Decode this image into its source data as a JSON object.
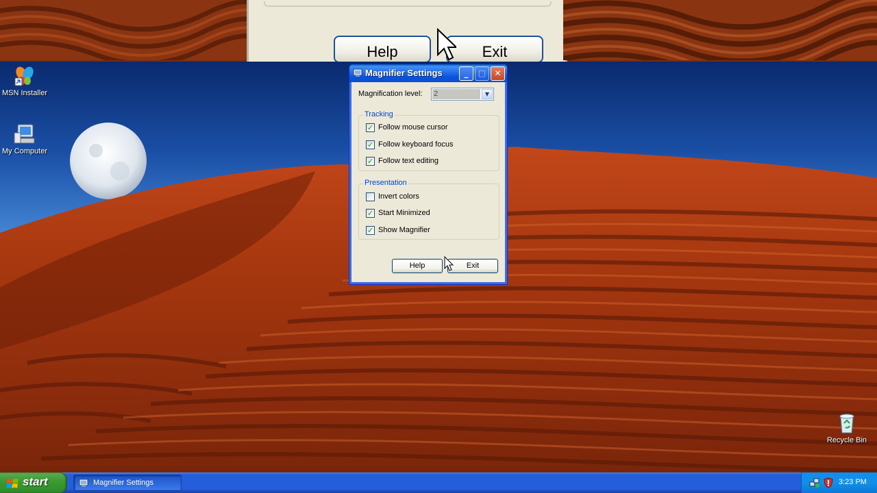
{
  "magnifier_pane": {
    "help_label": "Help",
    "exit_label": "Exit"
  },
  "desktop": {
    "icons": [
      {
        "label": "MSN Installer",
        "icon": "msn-butterfly-icon"
      },
      {
        "label": "My Computer",
        "icon": "my-computer-icon"
      },
      {
        "label": "Recycle Bin",
        "icon": "recycle-bin-icon"
      }
    ]
  },
  "window": {
    "title": "Magnifier Settings",
    "magnification_label": "Magnification level:",
    "magnification_value": "2",
    "tracking": {
      "title": "Tracking",
      "items": [
        {
          "label": "Follow mouse cursor",
          "checked": true
        },
        {
          "label": "Follow keyboard focus",
          "checked": true
        },
        {
          "label": "Follow text editing",
          "checked": true
        }
      ]
    },
    "presentation": {
      "title": "Presentation",
      "items": [
        {
          "label": "Invert colors",
          "checked": false
        },
        {
          "label": "Start Minimized",
          "checked": true
        },
        {
          "label": "Show Magnifier",
          "checked": true
        }
      ]
    },
    "help_label": "Help",
    "exit_label": "Exit"
  },
  "taskbar": {
    "start_label": "start",
    "task_label": "Magnifier Settings",
    "clock": "3:23 PM"
  },
  "colors": {
    "titlebar": "#0a5bd6",
    "group_title": "#0046d5",
    "start_green": "#3c9b33",
    "taskbar_blue": "#245edb"
  }
}
